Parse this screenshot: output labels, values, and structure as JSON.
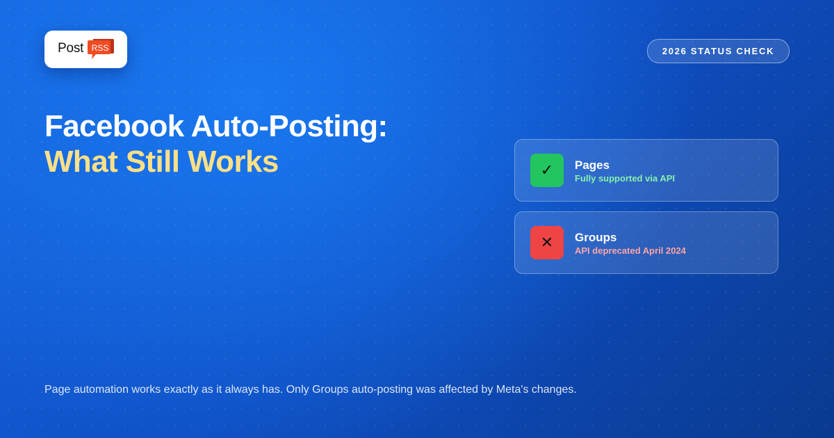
{
  "brand": {
    "name_part1": "Post",
    "name_badge": "RSS",
    "badge_color": "#f04b23"
  },
  "header": {
    "status_label": "2026 STATUS CHECK"
  },
  "headline": {
    "line1": "Facebook Auto-Posting:",
    "line2": "What Still Works",
    "accent_color": "#fde087"
  },
  "statuses": [
    {
      "icon": "check-icon",
      "glyph": "✓",
      "title": "Pages",
      "subtitle": "Fully supported via API",
      "color": "#22c55e"
    },
    {
      "icon": "x-icon",
      "glyph": "✕",
      "title": "Groups",
      "subtitle": "API deprecated April 2024",
      "color": "#ef4444"
    }
  ],
  "footer": {
    "note": "Page automation works exactly as it always has. Only Groups auto-posting was affected by Meta's changes."
  }
}
